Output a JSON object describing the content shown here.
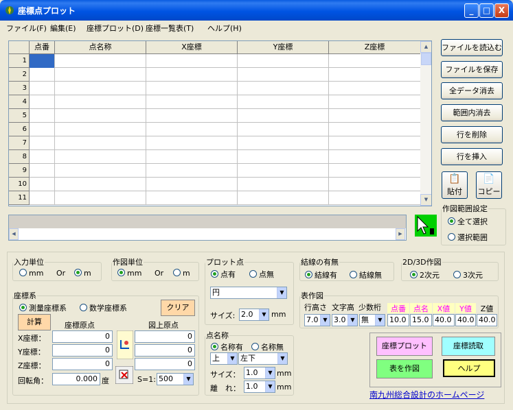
{
  "window": {
    "title": "座標点プロット",
    "icon": "compass-icon",
    "minimize": "_",
    "maximize": "□",
    "close": "X"
  },
  "menu": [
    "ファイル(F)",
    "編集(E)",
    "座標プロット(D)",
    "座標一覧表(T)",
    "ヘルプ(H)"
  ],
  "grid": {
    "headers": [
      "点番",
      "点名称",
      "X座標",
      "Y座標",
      "Z座標"
    ],
    "rows": [
      "1",
      "2",
      "3",
      "4",
      "5",
      "6",
      "7",
      "8",
      "9",
      "10",
      "11"
    ]
  },
  "right_buttons": [
    "ファイルを読込む",
    "ファイルを保存",
    "全データ消去",
    "範囲内消去",
    "行を削除",
    "行を挿入"
  ],
  "paste": "貼付",
  "copy": "コピー",
  "plot_range": {
    "title": "作図範囲設定",
    "opt1": "全て選択",
    "opt2": "選択範囲"
  },
  "input_unit": {
    "title": "入力単位",
    "mm": "mm",
    "or": "Or",
    "m": "m"
  },
  "draw_unit": {
    "title": "作図単位",
    "mm": "mm",
    "or": "Or",
    "m": "m"
  },
  "plot_point": {
    "title": "プロット点",
    "yes": "点有",
    "no": "点無",
    "shape": "円",
    "size_label": "サイズ:",
    "size": "2.0",
    "unit": "mm"
  },
  "tie_line": {
    "title": "結線の有無",
    "yes": "結線有",
    "no": "結線無"
  },
  "dim": {
    "title": "2D/3D作図",
    "d2": "2次元",
    "d3": "3次元"
  },
  "coord": {
    "title": "座標系",
    "survey": "測量座標系",
    "math": "数学座標系",
    "clear": "クリア",
    "calc": "計算",
    "origin": "座標原点",
    "map_origin": "図上原点",
    "x": "X座標：",
    "y": "Y座標：",
    "z": "Z座標：",
    "rot": "回転角：",
    "deg": "度",
    "x_val": "0",
    "y_val": "0",
    "z_val": "0",
    "rot_val": "0.000",
    "mx": "0",
    "my": "0",
    "mz": "0",
    "scale_label": "S=1:",
    "scale": "500"
  },
  "point_name": {
    "title": "点名称",
    "yes": "名称有",
    "no": "名称無",
    "pos1": "上",
    "pos2": "左下",
    "size_label": "サイズ：",
    "size": "1.0",
    "unit": "mm",
    "gap_label": "離　れ：",
    "gap": "1.0",
    "unit2": "mm"
  },
  "table": {
    "title": "表作図",
    "row_h": "行高さ",
    "char_h": "文字高",
    "dec": "少数桁",
    "cols": [
      "点番",
      "点名",
      "X値",
      "Y値",
      "Z値"
    ],
    "row_h_val": "7.0",
    "char_h_val": "3.0",
    "dec_val": "無",
    "w": [
      "10.0",
      "15.0",
      "40.0",
      "40.0",
      "40.0"
    ]
  },
  "actions": {
    "plot": "座標プロット",
    "read": "座標読取",
    "table": "表を作図",
    "help": "ヘルプ"
  },
  "link": "南九州総合設計のホームページ",
  "colors": {
    "plot": "#ffc0ff",
    "read": "#a0ffff",
    "table": "#80ff80",
    "help": "#ffff80",
    "link": "#0000cc"
  }
}
